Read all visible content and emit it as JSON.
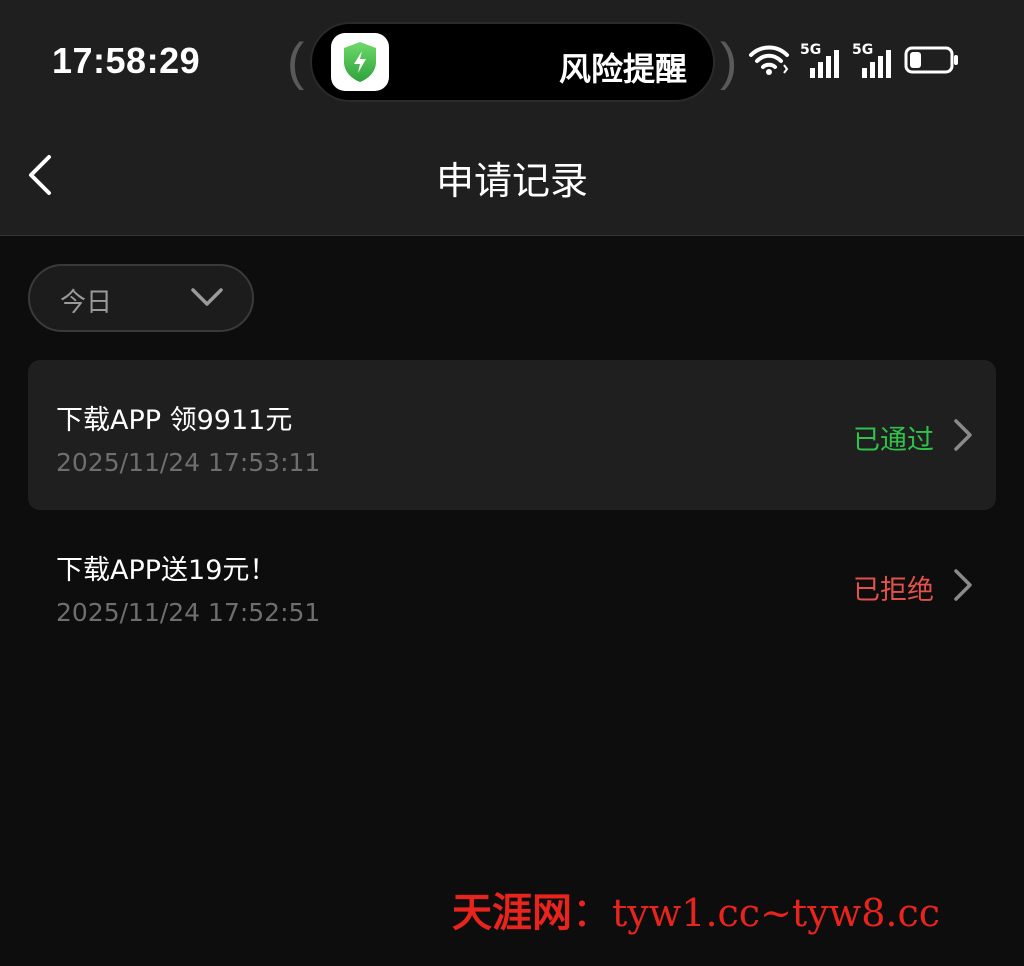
{
  "status_bar": {
    "time": "17:58:29",
    "island_text": "风险提醒",
    "island_icon": "shield-lightning-icon",
    "signal_labels": [
      "5G",
      "5G"
    ],
    "battery_level": 0.3,
    "accent_icon_color": "#3fbf4f"
  },
  "nav": {
    "title": "申请记录",
    "back_icon": "chevron-left-icon"
  },
  "filter": {
    "selected": "今日"
  },
  "records": [
    {
      "title": "下载APP 领9911元",
      "time": "2025/11/24 17:53:11",
      "status": "已通过",
      "status_color": "#2fc24a"
    },
    {
      "title": "下载APP送19元！",
      "time": "2025/11/24 17:52:51",
      "status": "已拒绝",
      "status_color": "#e2514a"
    }
  ],
  "watermark": {
    "name": "天涯网",
    "separator": "：",
    "url": "tyw1.cc~tyw8.cc"
  }
}
